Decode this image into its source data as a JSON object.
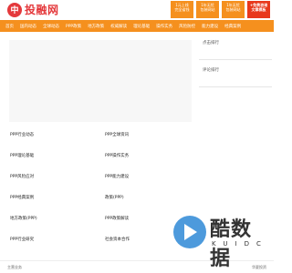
{
  "header": {
    "logo_mark": "中",
    "logo_text": "投融网",
    "boxes": [
      {
        "line1": "1元上线",
        "line2": "完全省钱"
      },
      {
        "line1": "1年无忧",
        "line2": "包装网站"
      },
      {
        "line1": "1年无忧",
        "line2": "包装网站"
      },
      {
        "line1": "+免费咨询",
        "line2": "文章模板"
      }
    ]
  },
  "nav": {
    "items": [
      "首页",
      "国内动态",
      "全球动态",
      "PPP政策",
      "地方政策",
      "权威解读",
      "理论基础",
      "操作实务",
      "风险防控",
      "能力建设",
      "经典案例"
    ]
  },
  "grid": {
    "rows": [
      [
        "PPP行业动态",
        "PPP全球资讯"
      ],
      [
        "PPP理论基础",
        "PPP操作实务"
      ],
      [
        "PPP风险应对",
        "PPP能力建设"
      ],
      [
        "PPP经典案例",
        "政策(PPP)"
      ],
      [
        "地方政策(PPP)",
        "PPP政策解读"
      ],
      [
        "PPP行业研究",
        "社会资本合作"
      ]
    ]
  },
  "sidebar": {
    "panels": [
      "点击排行",
      "评论排行"
    ]
  },
  "footer": {
    "left": "主营业务",
    "right": "华夏投资"
  },
  "watermark": {
    "text": "酷数据",
    "sub": "KUIDC"
  }
}
